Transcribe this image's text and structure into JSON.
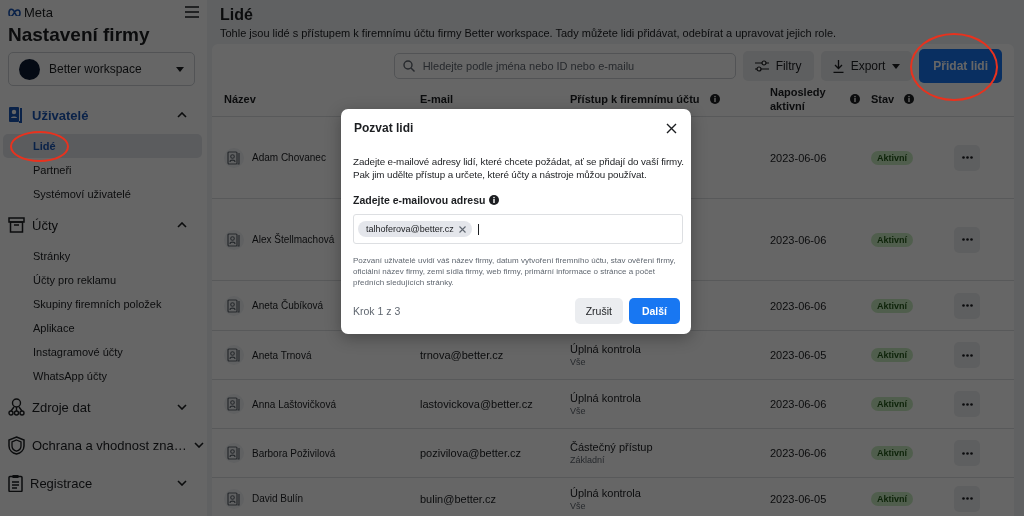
{
  "app": {
    "brand": "Meta",
    "title": "Nastavení firmy",
    "account": "Better workspace"
  },
  "nav": [
    {
      "label": "Uživatelé",
      "expanded": true,
      "children": [
        {
          "label": "Lidé",
          "selected": true,
          "circled": true
        },
        {
          "label": "Partneři",
          "selected": false,
          "circled": false
        },
        {
          "label": "Systémoví uživatelé",
          "selected": false,
          "circled": false
        }
      ]
    },
    {
      "label": "Účty",
      "expanded": true,
      "children": [
        {
          "label": "Stránky",
          "selected": false,
          "circled": false
        },
        {
          "label": "Účty pro reklamu",
          "selected": false,
          "circled": false
        },
        {
          "label": "Skupiny firemních položek",
          "selected": false,
          "circled": false
        },
        {
          "label": "Aplikace",
          "selected": false,
          "circled": false
        },
        {
          "label": "Instagramové účty",
          "selected": false,
          "circled": false
        },
        {
          "label": "WhatsApp účty",
          "selected": false,
          "circled": false
        }
      ]
    },
    {
      "label": "Zdroje dat",
      "expanded": false
    },
    {
      "label": "Ochrana a vhodnost zna…",
      "expanded": false
    },
    {
      "label": "Registrace",
      "expanded": false
    }
  ],
  "page": {
    "title": "Lidé",
    "description": "Tohle jsou lidé s přístupem k firemnímu účtu firmy Better workspace. Tady můžete lidi přidávat, odebírat a upravovat jejich role."
  },
  "toolbar": {
    "search_placeholder": "Hledejte podle jména nebo ID nebo e-mailu",
    "filter": "Filtry",
    "export": "Export",
    "add": {
      "label": "Přidat lidi",
      "circled": true
    }
  },
  "table": {
    "columns": [
      {
        "label": "Název",
        "info": false
      },
      {
        "label": "E-mail",
        "info": false
      },
      {
        "label": "Přístup k firemnímu účtu",
        "info": true
      },
      {
        "label": "Naposledy aktivní",
        "info": true
      },
      {
        "label": "Stav",
        "info": true
      }
    ],
    "rows": [
      {
        "name": "Adam Chovanec",
        "last_active": "2023-06-06",
        "status": "Aktivní"
      },
      {
        "name": "Alex Štellmachová",
        "last_active": "2023-06-06",
        "status": "Aktivní"
      },
      {
        "name": "Aneta Čubíková",
        "last_active": "2023-06-06",
        "status": "Aktivní"
      },
      {
        "name": "Aneta Trnová",
        "email": "trnova@better.cz",
        "access": "Úplná kontrola",
        "access_detail": "Vše",
        "last_active": "2023-06-05",
        "status": "Aktivní"
      },
      {
        "name": "Anna Laštovičková",
        "email": "lastovickova@better.cz",
        "access": "Úplná kontrola",
        "access_detail": "Vše",
        "last_active": "2023-06-06",
        "status": "Aktivní"
      },
      {
        "name": "Barbora Poživilová",
        "email": "pozivilova@better.cz",
        "access": "Částečný přístup",
        "access_detail": "Základní",
        "last_active": "2023-06-06",
        "status": "Aktivní"
      },
      {
        "name": "David Bulín",
        "email": "bulin@better.cz",
        "access": "Úplná kontrola",
        "access_detail": "Vše",
        "last_active": "2023-06-05",
        "status": "Aktivní"
      }
    ]
  },
  "dialog": {
    "title": "Pozvat lidi",
    "intro": "Zadejte e-mailové adresy lidí, které chcete požádat, ať se přidají do vaší firmy. Pak jim udělte přístup a určete, které účty a nástroje můžou používat.",
    "field_label": "Zadejte e-mailovou adresu",
    "chips": [
      "talhoferova@better.cz"
    ],
    "note": "Pozvaní uživatelé uvidí váš název firmy, datum vytvoření firemního účtu, stav ověření firmy, oficiální název firmy, zemi sídla firmy, web firmy, primární informace o stránce a počet předních sledujících stránky.",
    "step": "Krok 1 z 3",
    "cancel": "Zrušit",
    "next": "Další"
  }
}
